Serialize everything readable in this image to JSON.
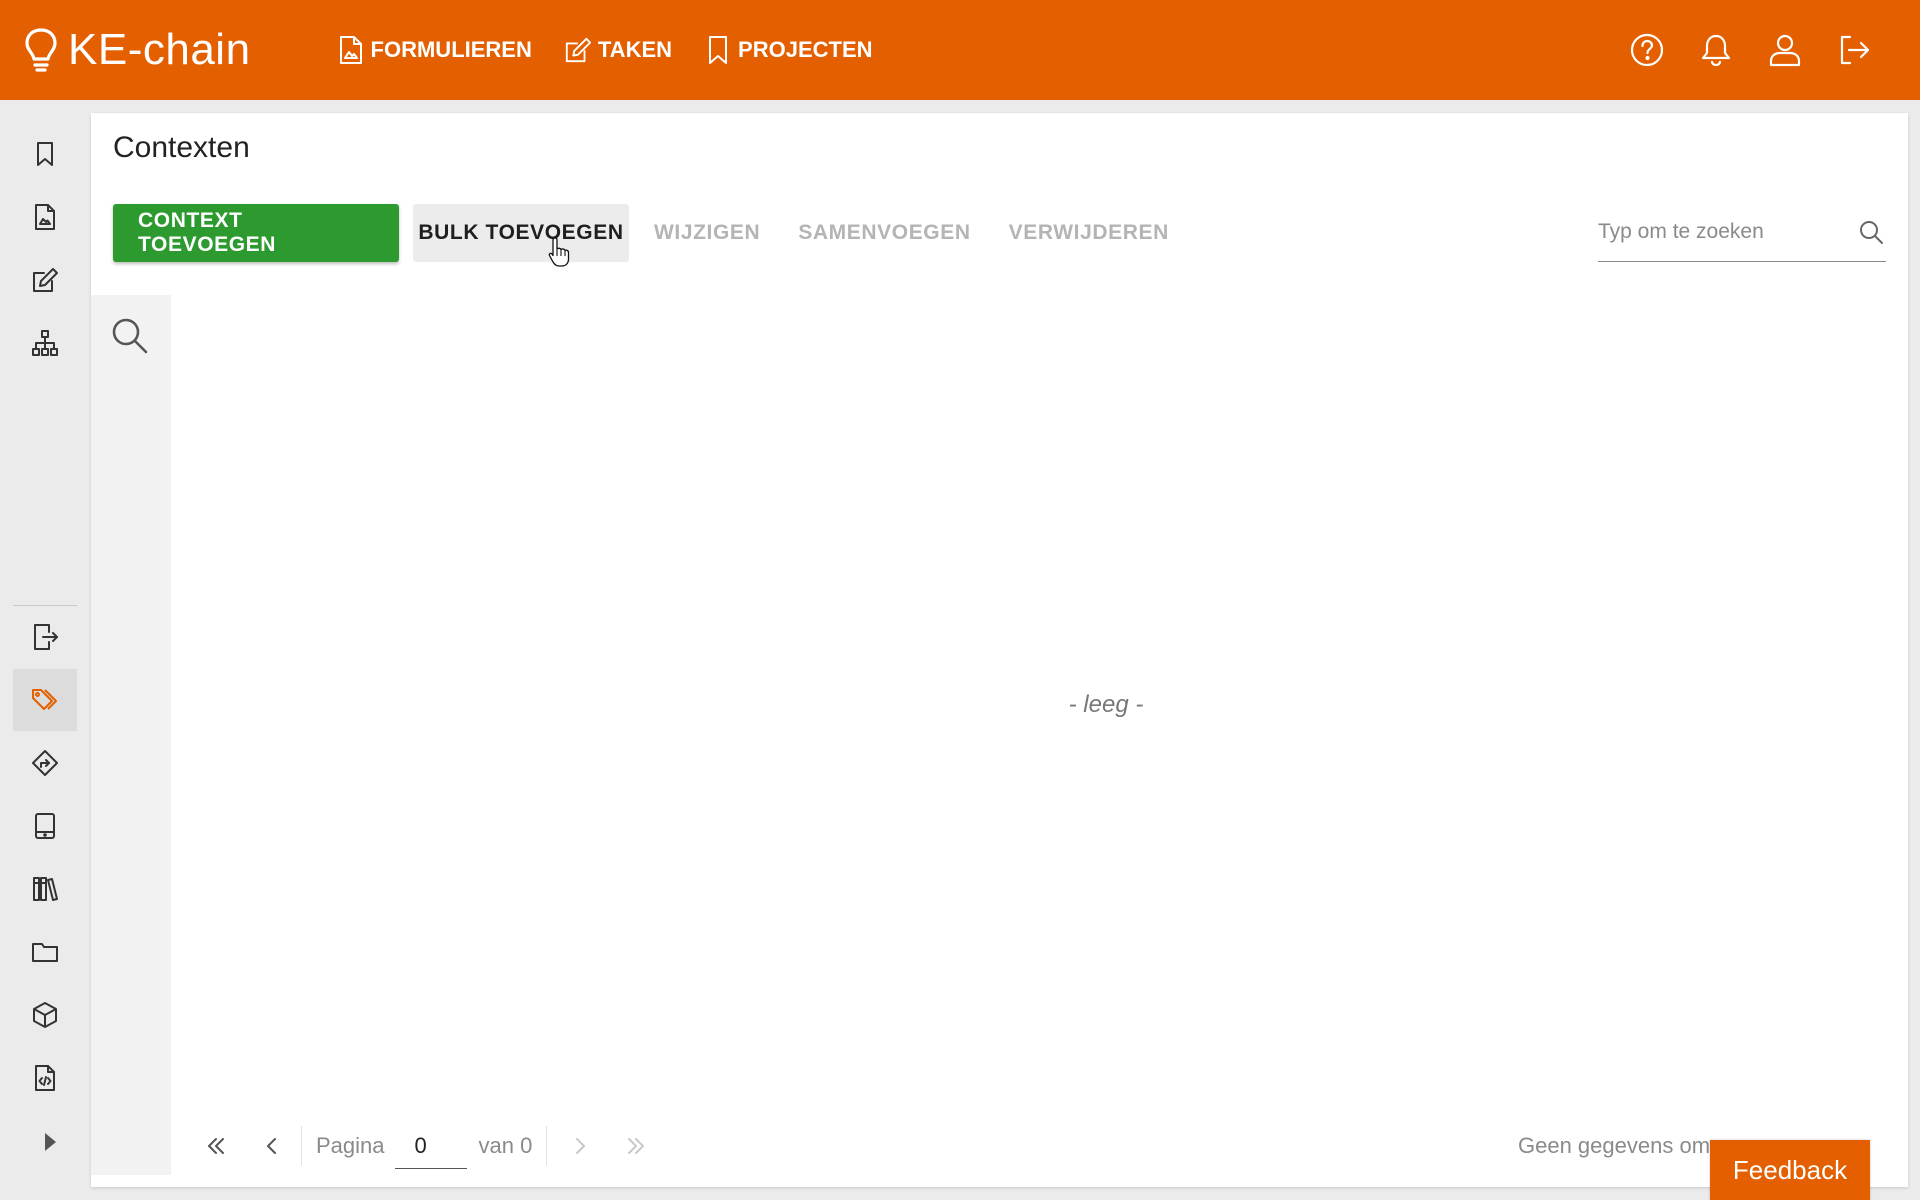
{
  "app": {
    "brand_name": "KE-chain",
    "accent_color": "#e35f00",
    "success_color": "#2d9a2f"
  },
  "topnav": [
    {
      "label": "FORMULIEREN",
      "icon": "form-icon"
    },
    {
      "label": "TAKEN",
      "icon": "edit-icon"
    },
    {
      "label": "PROJECTEN",
      "icon": "bookmark-icon"
    }
  ],
  "topbar_icons": [
    "help-icon",
    "bell-icon",
    "user-icon",
    "logout-icon"
  ],
  "sidebar": {
    "top_items": [
      "bookmark-icon",
      "form-icon",
      "edit-icon",
      "sitemap-icon"
    ],
    "bottom_items": [
      "export-icon",
      "tags-icon",
      "route-icon",
      "tablet-icon",
      "library-icon",
      "folder-icon",
      "cube-icon",
      "script-file-icon"
    ],
    "active_item": "tags-icon"
  },
  "page": {
    "title": "Contexten"
  },
  "toolbar": {
    "add_label": "CONTEXT TOEVOEGEN",
    "bulk_label": "BULK TOEVOEGEN",
    "edit_label": "WIJZIGEN",
    "merge_label": "SAMENVOEGEN",
    "delete_label": "VERWIJDEREN"
  },
  "search": {
    "placeholder": "Typ om te zoeken",
    "value": ""
  },
  "table": {
    "empty_text": "- leeg -"
  },
  "pagination": {
    "page_label": "Pagina",
    "page_value": "0",
    "of_label": "van 0",
    "no_data_text": "Geen gegevens om"
  },
  "feedback": {
    "label": "Feedback"
  }
}
